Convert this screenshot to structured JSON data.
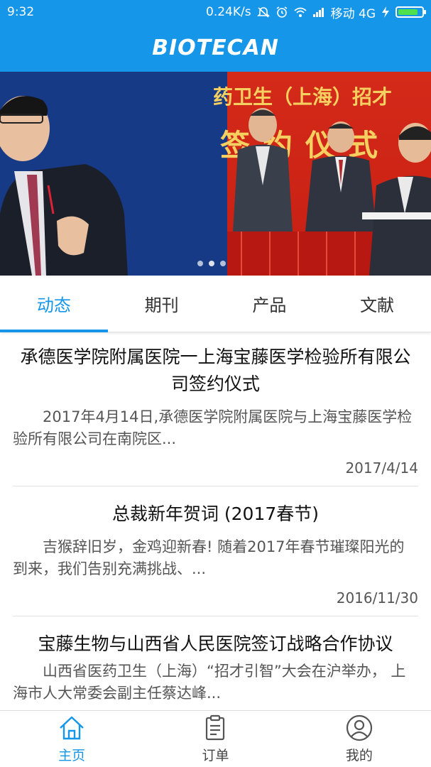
{
  "status_bar": {
    "time": "9:32",
    "speed": "0.24K/s",
    "carrier": "移动 4G",
    "battery_level": 0.85,
    "icons": [
      "mute-icon",
      "alarm-icon",
      "wifi-icon",
      "signal-icon",
      "charging-icon",
      "battery-icon"
    ]
  },
  "header": {
    "logo_text": "BIOTECAN"
  },
  "banner": {
    "slide_text_line1": "药卫生（上海）招才",
    "slide_text_line2": "签约仪式",
    "dots_count": 3,
    "active_dot": 1
  },
  "tabs": [
    {
      "label": "动态",
      "active": true
    },
    {
      "label": "期刊",
      "active": false
    },
    {
      "label": "产品",
      "active": false
    },
    {
      "label": "文献",
      "active": false
    }
  ],
  "news": [
    {
      "title": "承德医学院附属医院一上海宝藤医学检验所有限公司签约仪式",
      "excerpt": "2017年4月14日,承德医学院附属医院与上海宝藤医学检验所有限公司在南院区...",
      "date": "2017/4/14"
    },
    {
      "title": "总裁新年贺词 (2017春节)",
      "excerpt": "吉猴辞旧岁，金鸡迎新春! 随着2017年春节璀璨阳光的到来，我们告别充满挑战、...",
      "date": "2016/11/30"
    },
    {
      "title": "宝藤生物与山西省人民医院签订战略合作协议",
      "excerpt": "山西省医药卫生（上海）“招才引智”大会在沪举办， 上海市人大常委会副主任蔡达峰...",
      "date": ""
    }
  ],
  "bottom_nav": [
    {
      "label": "主页",
      "icon": "home-icon",
      "active": true
    },
    {
      "label": "订单",
      "icon": "clipboard-icon",
      "active": false
    },
    {
      "label": "我的",
      "icon": "user-icon",
      "active": false
    }
  ],
  "colors": {
    "primary": "#1596e8",
    "banner_red": "#c61f12",
    "banner_blue": "#12306f"
  }
}
